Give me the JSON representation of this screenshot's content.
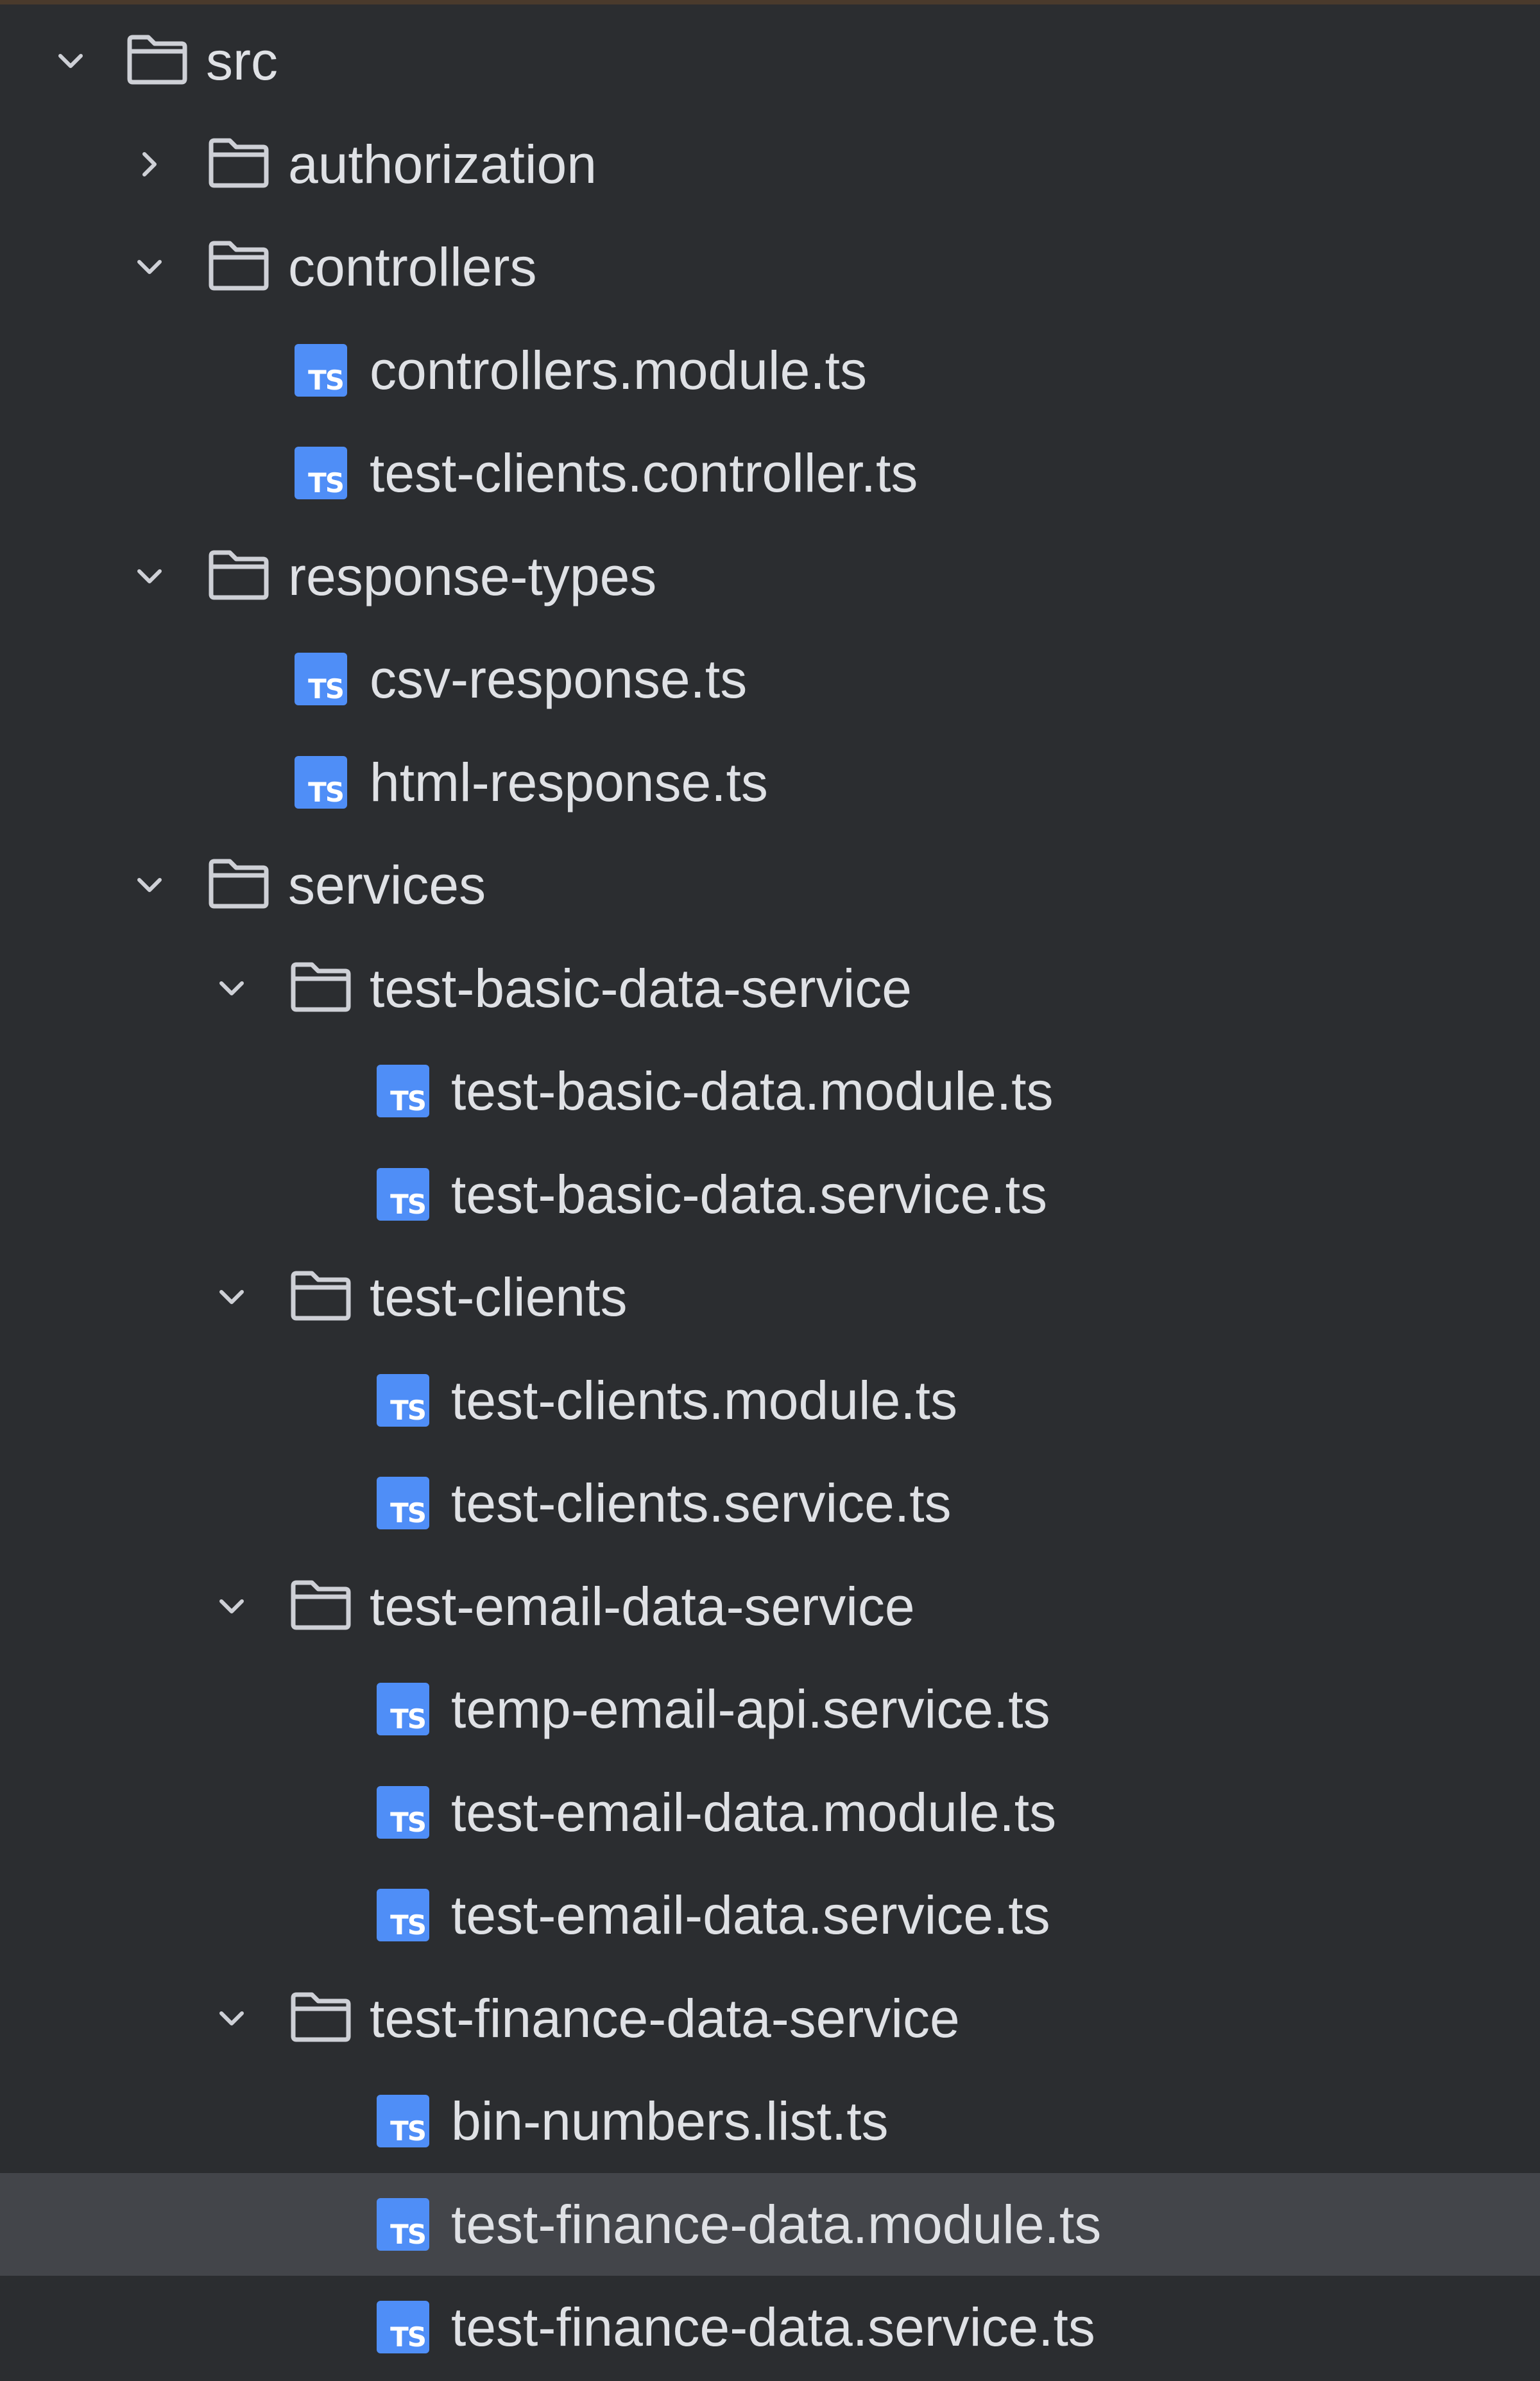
{
  "project_tree": {
    "root": {
      "label": "src"
    },
    "authorization": {
      "label": "authorization"
    },
    "controllers": {
      "label": "controllers",
      "files": [
        "controllers.module.ts",
        "test-clients.controller.ts"
      ]
    },
    "response_types": {
      "label": "response-types",
      "files": [
        "csv-response.ts",
        "html-response.ts"
      ]
    },
    "services": {
      "label": "services",
      "basic": {
        "label": "test-basic-data-service",
        "files": [
          "test-basic-data.module.ts",
          "test-basic-data.service.ts"
        ]
      },
      "clients": {
        "label": "test-clients",
        "files": [
          "test-clients.module.ts",
          "test-clients.service.ts"
        ]
      },
      "email": {
        "label": "test-email-data-service",
        "files": [
          "temp-email-api.service.ts",
          "test-email-data.module.ts",
          "test-email-data.service.ts"
        ]
      },
      "finance": {
        "label": "test-finance-data-service",
        "files": [
          "bin-numbers.list.ts",
          "test-finance-data.module.ts",
          "test-finance-data.service.ts"
        ]
      }
    },
    "selected_file": "test-finance-data.module.ts",
    "file_icon_text": "TS"
  },
  "colors": {
    "background": "#2b2d30",
    "selected_row": "#43454a",
    "text": "#dfe1e5",
    "icon_gray": "#ced0d6",
    "ts_badge": "#4f8ef7"
  }
}
